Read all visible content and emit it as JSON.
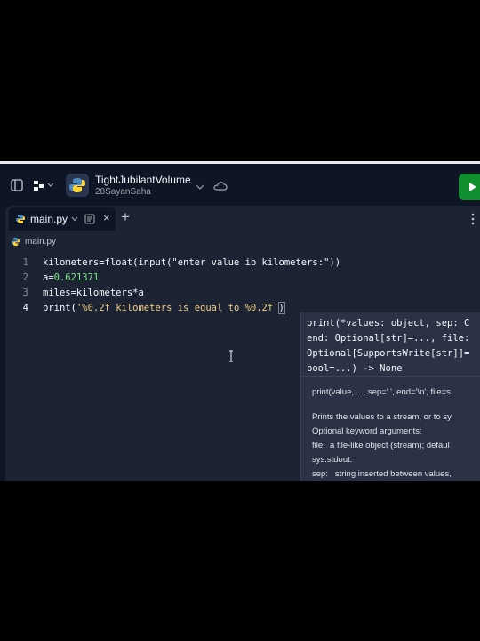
{
  "window": {
    "title": "TightJubilantVolume",
    "subtitle": "28SayanSaha"
  },
  "tab": {
    "label": "main.py",
    "close": "×",
    "add": "+"
  },
  "breadcrumb": {
    "label": "main.py"
  },
  "editor": {
    "lines": [
      {
        "num": "1",
        "code": "kilometers=float(input(\"enter value ib kilometers:\"))"
      },
      {
        "num": "2",
        "prefix": "a=",
        "number": "0.621371"
      },
      {
        "num": "3",
        "code": "miles=kilometers*a"
      },
      {
        "num": "4",
        "prefix": "print(",
        "string": "'%0.2f kilometers is equal to %0.2f'",
        "suffix": ")"
      }
    ]
  },
  "hover": {
    "signature": [
      "print(*values: object, sep: C",
      "end: Optional[str]=..., file:",
      "Optional[SupportsWrite[str]]=",
      "bool=...) -> None"
    ],
    "doc": [
      "print(value, ..., sep=' ', end='\\n', file=s",
      "",
      "Prints the values to a stream, or to sy",
      "Optional keyword arguments:",
      "file:  a file-like object (stream); defaul",
      "sys.stdout.",
      "sep:   string inserted between values,"
    ]
  },
  "colors": {
    "accent": "#0f8f2e",
    "background": "#1c2333",
    "string": "#f0ce84",
    "number": "#7ee787"
  }
}
